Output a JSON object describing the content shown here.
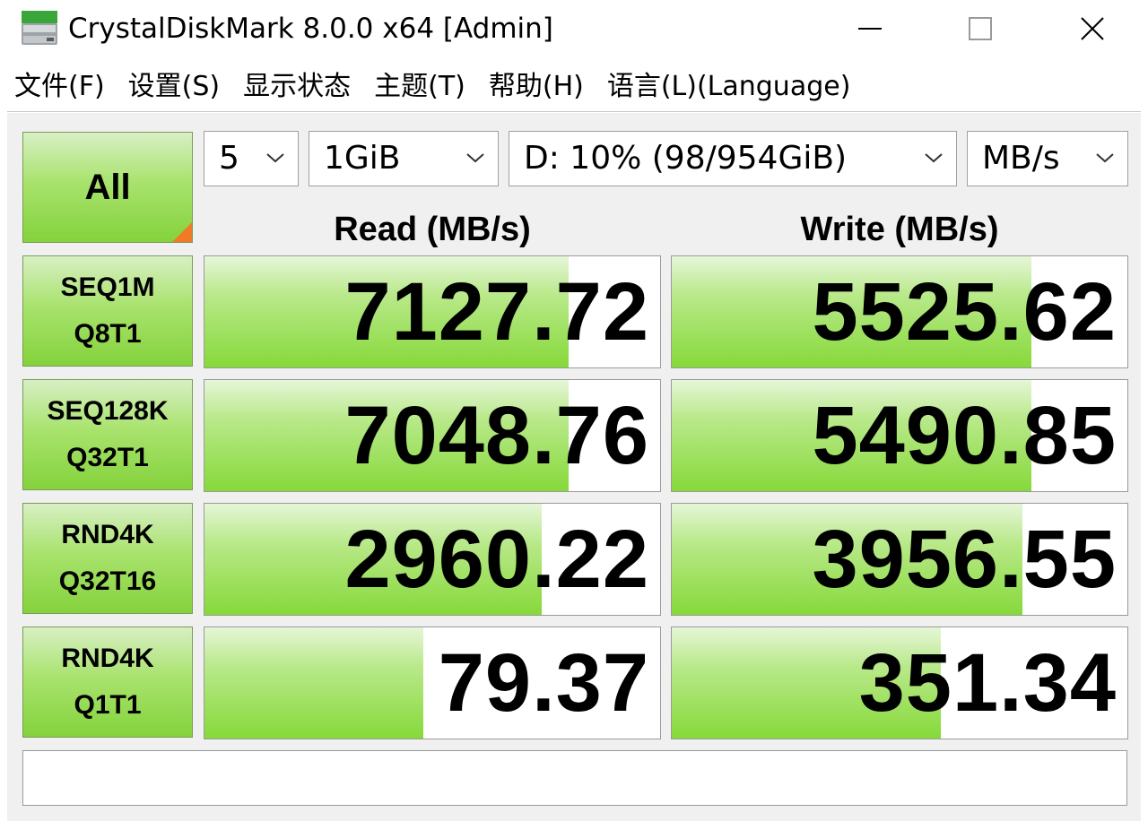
{
  "window": {
    "title": "CrystalDiskMark 8.0.0 x64 [Admin]"
  },
  "menu": [
    {
      "label": "文件(F)"
    },
    {
      "label": "设置(S)"
    },
    {
      "label": "显示状态"
    },
    {
      "label": "主题(T)"
    },
    {
      "label": "帮助(H)"
    },
    {
      "label": "语言(L)(Language)"
    }
  ],
  "controls": {
    "all_label": "All",
    "count": "5",
    "size": "1GiB",
    "drive": "D: 10% (98/954GiB)",
    "unit": "MB/s"
  },
  "headers": {
    "read": "Read (MB/s)",
    "write": "Write (MB/s)"
  },
  "tests": [
    {
      "line1": "SEQ1M",
      "line2": "Q8T1",
      "read": "7127.72",
      "write": "5525.62",
      "read_fill": 0.8,
      "write_fill": 0.79
    },
    {
      "line1": "SEQ128K",
      "line2": "Q32T1",
      "read": "7048.76",
      "write": "5490.85",
      "read_fill": 0.8,
      "write_fill": 0.79
    },
    {
      "line1": "RND4K",
      "line2": "Q32T16",
      "read": "2960.22",
      "write": "3956.55",
      "read_fill": 0.74,
      "write_fill": 0.77
    },
    {
      "line1": "RND4K",
      "line2": "Q1T1",
      "read": "79.37",
      "write": "351.34",
      "read_fill": 0.48,
      "write_fill": 0.59
    }
  ],
  "status_text": "",
  "colors": {
    "bar_green": "#86d93a",
    "button_green": "#84d23c",
    "corner_orange": "#f07a26"
  }
}
